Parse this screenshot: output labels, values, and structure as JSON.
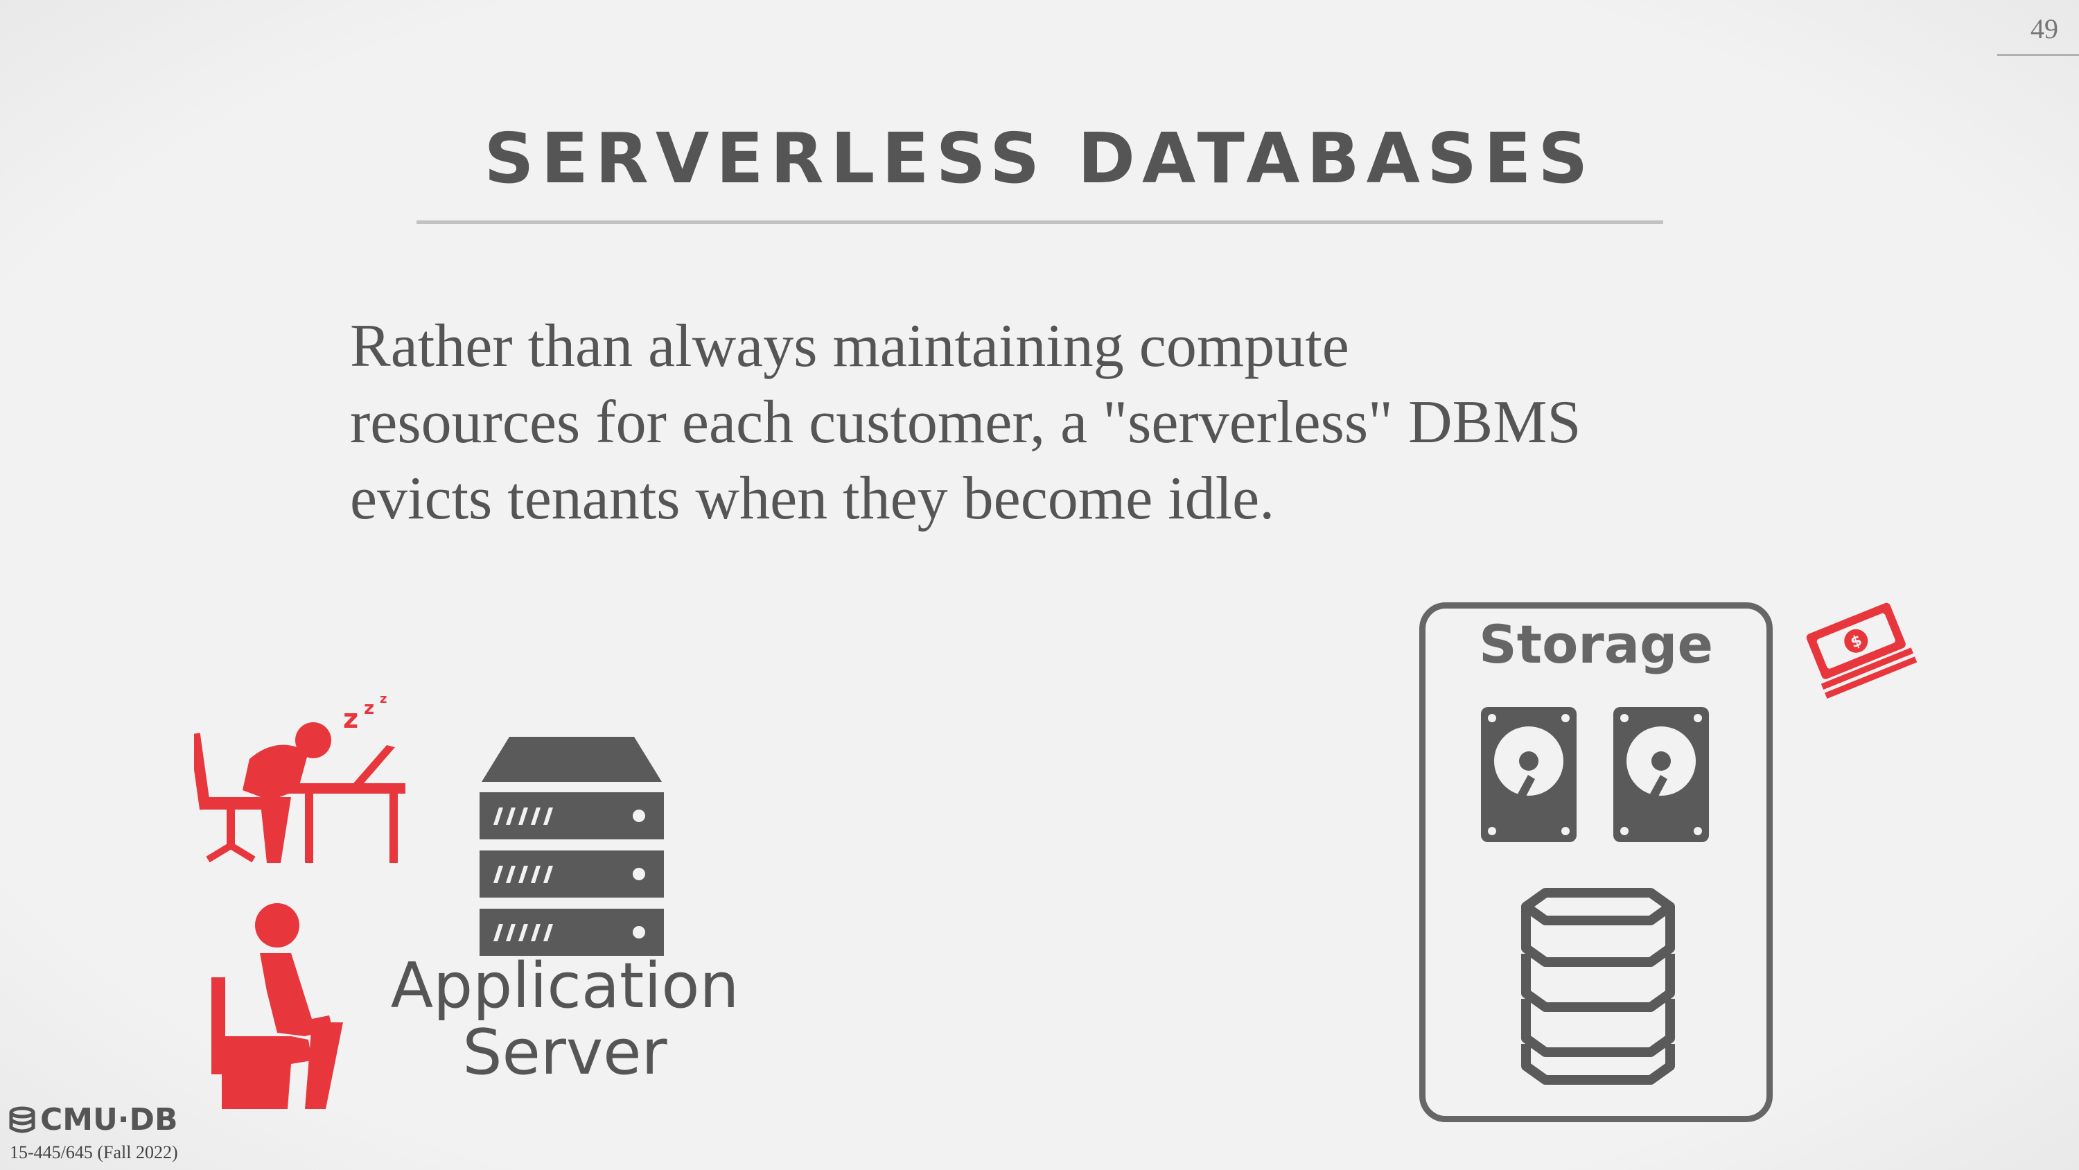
{
  "slide": {
    "page_number": "49",
    "title": "SERVERLESS DATABASES",
    "body_lines": [
      "Rather than always maintaining compute",
      "resources for each customer, a \"serverless\" DBMS",
      "evicts tenants when they become idle."
    ]
  },
  "diagram": {
    "app_server_label_line1": "Application",
    "app_server_label_line2": "Server",
    "storage_label": "Storage",
    "icons": [
      "sleeping-worker-icon",
      "toilet-person-icon",
      "server-rack-icon",
      "hard-drive-icon",
      "database-icon",
      "money-icon"
    ],
    "colors": {
      "accent_red": "#e8363d",
      "icon_gray": "#666666",
      "text_gray": "#555555"
    }
  },
  "footer": {
    "logo_text": "CMU·DB",
    "course": "15-445/645 (Fall 2022)"
  }
}
